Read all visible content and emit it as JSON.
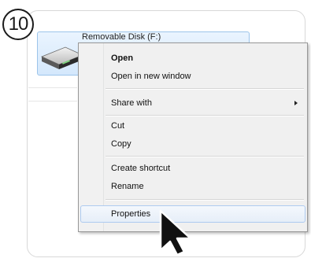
{
  "step": {
    "number": "10"
  },
  "drive": {
    "label": "Removable Disk (F:)",
    "icon": "removable-drive-icon"
  },
  "menu": {
    "open": "Open",
    "open_new_window": "Open in new window",
    "share_with": "Share with",
    "cut": "Cut",
    "copy": "Copy",
    "create_shortcut": "Create shortcut",
    "rename": "Rename",
    "properties": "Properties"
  },
  "colors": {
    "selection": "#d4e8fc",
    "menu_background": "#f0f0f0",
    "highlight_border": "#aecbf0"
  },
  "cursor": {
    "icon": "arrow-cursor-icon"
  }
}
